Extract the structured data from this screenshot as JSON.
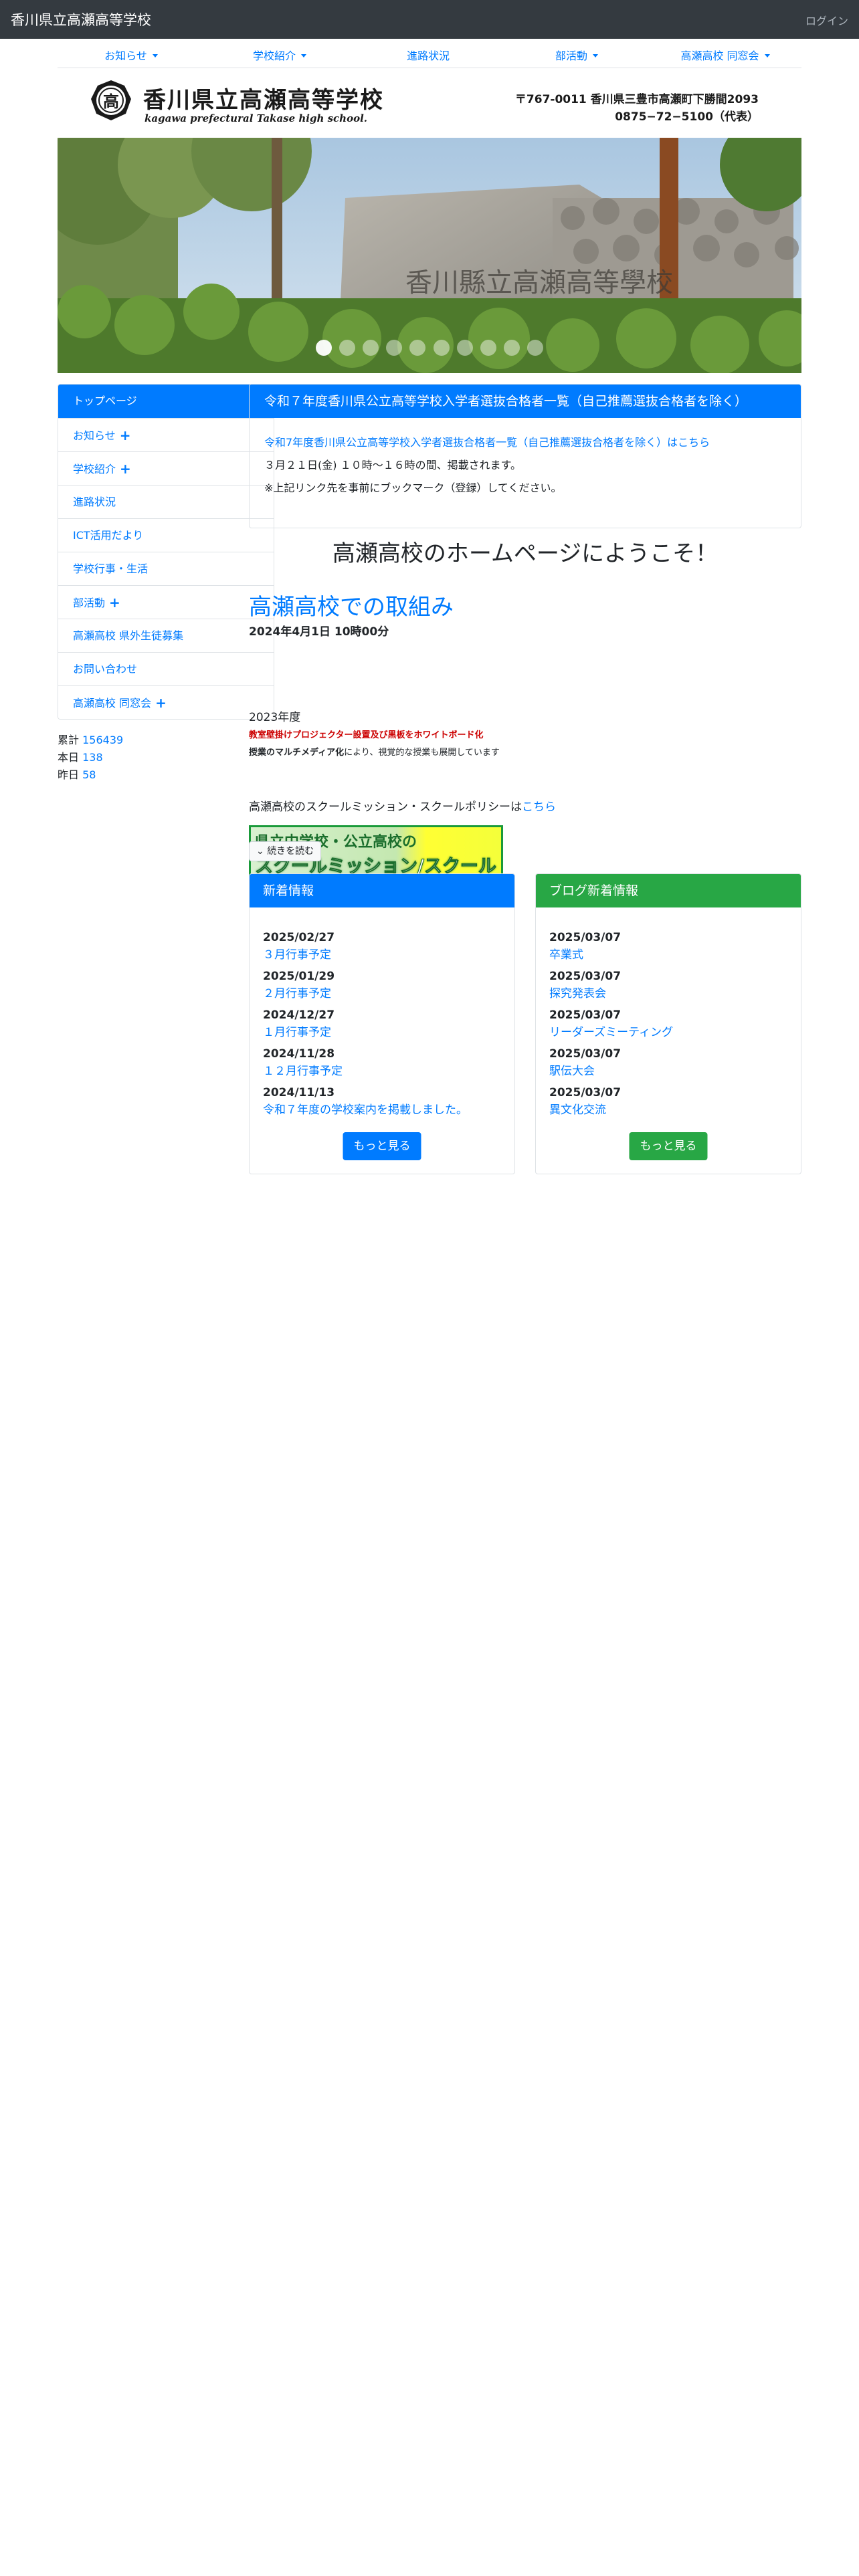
{
  "topbar": {
    "site_title": "香川県立高瀬高等学校",
    "login": "ログイン"
  },
  "menu": [
    {
      "label": "お知らせ",
      "dropdown": true
    },
    {
      "label": "学校紹介",
      "dropdown": true
    },
    {
      "label": "進路状況",
      "dropdown": false
    },
    {
      "label": "部活動",
      "dropdown": true
    },
    {
      "label": "高瀬高校 同窓会",
      "dropdown": true
    }
  ],
  "banner": {
    "emblem_char": "高",
    "name_jp": "香川県立高瀬高等学校",
    "name_en": "kagawa prefectural Takase high school.",
    "address": "〒767-0011 香川県三豊市高瀬町下勝間2093",
    "phone": "0875−72−5100（代表）"
  },
  "hero": {
    "stone_text": "香川縣立高瀬高等學校",
    "slide_count": 10,
    "active_slide": 1
  },
  "sidebar": [
    {
      "label": "トップページ",
      "active": true,
      "expand": false
    },
    {
      "label": "お知らせ",
      "active": false,
      "expand": true
    },
    {
      "label": "学校紹介",
      "active": false,
      "expand": true
    },
    {
      "label": "進路状況",
      "active": false,
      "expand": false
    },
    {
      "label": "ICT活用だより",
      "active": false,
      "expand": false
    },
    {
      "label": "学校行事・生活",
      "active": false,
      "expand": false
    },
    {
      "label": "部活動",
      "active": false,
      "expand": true
    },
    {
      "label": "高瀬高校 県外生徒募集",
      "active": false,
      "expand": false
    },
    {
      "label": "お問い合わせ",
      "active": false,
      "expand": false
    },
    {
      "label": "高瀬高校 同窓会",
      "active": false,
      "expand": true
    }
  ],
  "counter": {
    "total_label": "累計",
    "total": "156439",
    "today_label": "本日",
    "today": "138",
    "yesterday_label": "昨日",
    "yesterday": "58"
  },
  "notice": {
    "title": "令和７年度香川県公立高等学校入学者選抜合格者一覧（自己推薦選抜合格者を除く）",
    "link": "令和7年度香川県公立高等学校入学者選抜合格者一覧（自己推薦選抜合格者を除く）はこちら",
    "line1": "３月２１日(金) １０時〜１６時の間、掲載されます。",
    "line2": "※上記リンク先を事前にブックマーク（登録）してください。"
  },
  "welcome": "高瀬高校のホームページにようこそ！",
  "article": {
    "title": "高瀬高校での取組み",
    "date": "2024年4月1日 10時00分",
    "year": "2023年度",
    "red": "教室壁掛けプロジェクター設置及び黒板をホワイトボード化",
    "bold_part": "授業のマルチメディア化",
    "rest": "により、視覚的な授業も展開しています",
    "mission_text": "高瀬高校のスクールミッション・スクールポリシーは",
    "mission_link": "こちら",
    "mission_banner_top": "県立中学校・公立高校の",
    "mission_banner_bottom": "スクールミッション/スクールポリシー",
    "readmore": "続きを読む"
  },
  "news": {
    "title": "新着情報",
    "items": [
      {
        "date": "2025/02/27",
        "title": "３月行事予定"
      },
      {
        "date": "2025/01/29",
        "title": "２月行事予定"
      },
      {
        "date": "2024/12/27",
        "title": "１月行事予定"
      },
      {
        "date": "2024/11/28",
        "title": "１２月行事予定"
      },
      {
        "date": "2024/11/13",
        "title": "令和７年度の学校案内を掲載しました。"
      }
    ],
    "more": "もっと見る"
  },
  "blog": {
    "title": "ブログ新着情報",
    "items": [
      {
        "date": "2025/03/07",
        "title": "卒業式"
      },
      {
        "date": "2025/03/07",
        "title": "探究発表会"
      },
      {
        "date": "2025/03/07",
        "title": "リーダーズミーティング"
      },
      {
        "date": "2025/03/07",
        "title": "駅伝大会"
      },
      {
        "date": "2025/03/07",
        "title": "異文化交流"
      }
    ],
    "more": "もっと見る"
  }
}
